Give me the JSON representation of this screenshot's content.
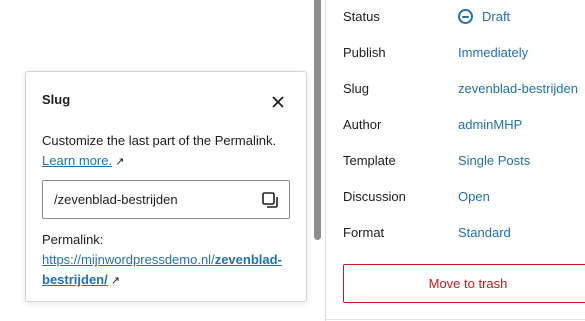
{
  "sidebar": {
    "rows": [
      {
        "label": "Status",
        "value": "Draft"
      },
      {
        "label": "Publish",
        "value": "Immediately"
      },
      {
        "label": "Slug",
        "value": "zevenblad-bestrijden"
      },
      {
        "label": "Author",
        "value": "adminMHP"
      },
      {
        "label": "Template",
        "value": "Single Posts"
      },
      {
        "label": "Discussion",
        "value": "Open"
      },
      {
        "label": "Format",
        "value": "Standard"
      }
    ],
    "trash_label": "Move to trash"
  },
  "popover": {
    "title": "Slug",
    "description": "Customize the last part of the Permalink.",
    "learn_more": "Learn more.",
    "slug_value": "/zevenblad-bestrijden",
    "permalink_label": "Permalink:",
    "permalink_base": "https://mijnwordpressdemo.nl/",
    "permalink_slug_part1": "zevenblad-",
    "permalink_slug_part2": "bestrijden/"
  },
  "colors": {
    "link": "#2271b1",
    "danger": "#cc1818",
    "text": "#1e1e1e"
  },
  "icons": {
    "close": "close-icon",
    "copy": "copy-icon",
    "external": "external-link-icon",
    "status": "draft-status-icon"
  }
}
